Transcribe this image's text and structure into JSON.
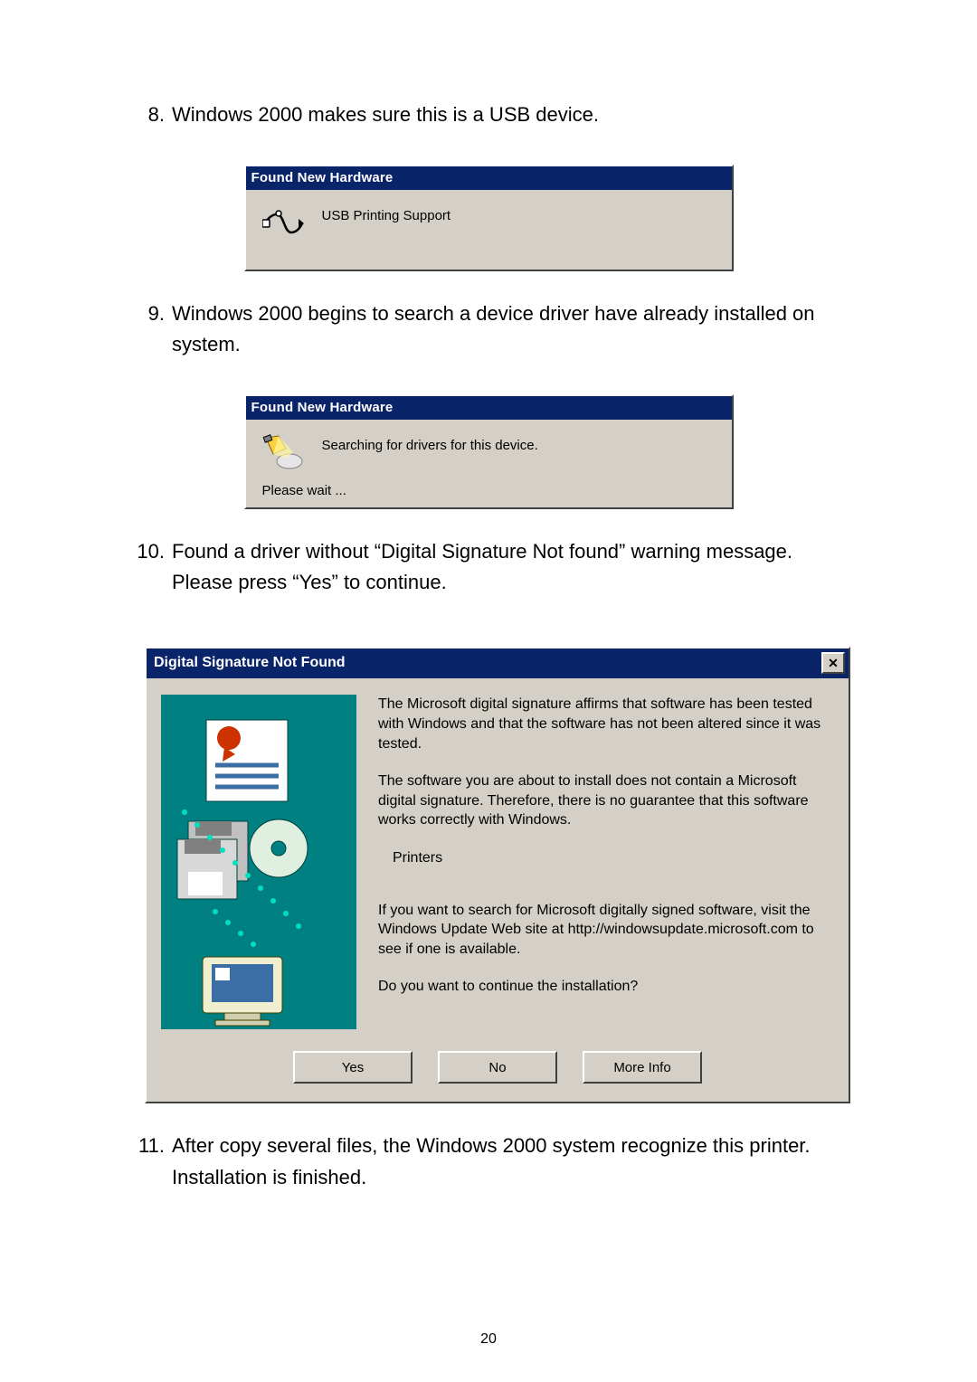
{
  "steps": {
    "s8": {
      "num": "8.",
      "text": "Windows 2000 makes sure this is a USB device."
    },
    "s9": {
      "num": "9.",
      "text": "Windows 2000 begins to search a device driver have already installed on system."
    },
    "s10": {
      "num": "10.",
      "text": "Found a driver without “Digital Signature Not found” warning message. Please press “Yes” to continue."
    },
    "s11": {
      "num": "11.",
      "text": "After copy several files, the Windows 2000 system recognize this printer. Installation is finished."
    }
  },
  "fnh1": {
    "title": "Found New Hardware",
    "body": "USB Printing Support"
  },
  "fnh2": {
    "title": "Found New Hardware",
    "body": "Searching for drivers for this device.",
    "footer": "Please wait ..."
  },
  "dsig": {
    "title": "Digital Signature Not Found",
    "close": "✕",
    "p1": "The Microsoft digital signature affirms that software has been tested with Windows and that the software has not been altered since it was tested.",
    "p2": "The software you are about to install does not contain a Microsoft digital signature. Therefore,  there is no guarantee that this software works correctly with Windows.",
    "p3": "Printers",
    "p4": "If you want to search for Microsoft digitally signed software, visit the Windows Update Web site at http://windowsupdate.microsoft.com to see if one is available.",
    "p5": "Do you want to continue the installation?",
    "buttons": {
      "yes": "Yes",
      "no": "No",
      "more": "More Info"
    }
  },
  "page_number": "20"
}
